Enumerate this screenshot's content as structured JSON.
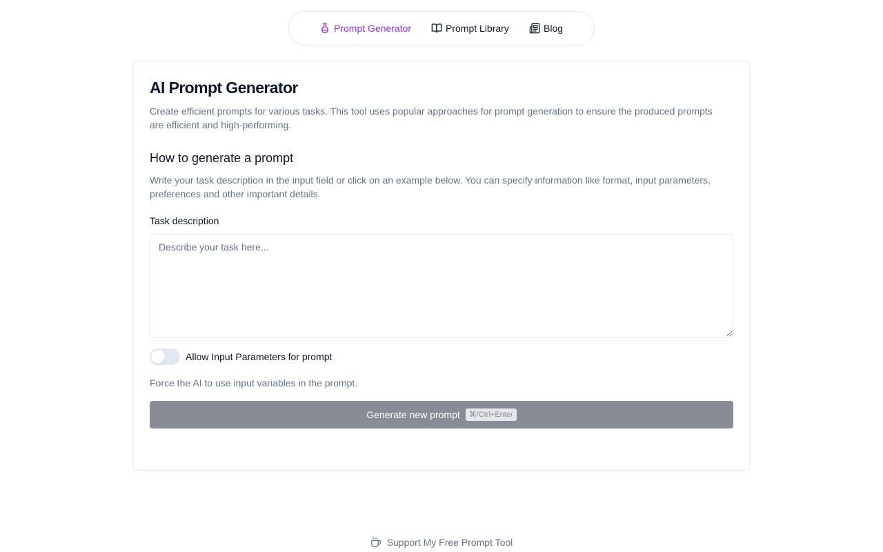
{
  "nav": {
    "items": [
      {
        "label": "Prompt Generator",
        "icon": "flask-icon",
        "active": true
      },
      {
        "label": "Prompt Library",
        "icon": "book-open-icon",
        "active": false
      },
      {
        "label": "Blog",
        "icon": "newspaper-icon",
        "active": false
      }
    ],
    "active_color": "#9333ea"
  },
  "main": {
    "title": "AI Prompt Generator",
    "description": "Create efficient prompts for various tasks. This tool uses popular approaches for prompt generation to ensure the produced prompts are efficient and high-performing.",
    "section_title": "How to generate a prompt",
    "section_description": "Write your task description in the input field or click on an example below. You can specify information like format, input parameters, preferences and other important details.",
    "task_label": "Task description",
    "task_placeholder": "Describe your task here...",
    "task_value": "",
    "toggle_label": "Allow Input Parameters for prompt",
    "toggle_on": false,
    "toggle_hint": "Force the AI to use input variables in the prompt.",
    "generate_label": "Generate new prompt",
    "generate_shortcut": "⌘/Ctrl+Enter"
  },
  "footer": {
    "support_label": "Support My Free Prompt Tool",
    "support_icon": "coffee-cup-icon"
  }
}
